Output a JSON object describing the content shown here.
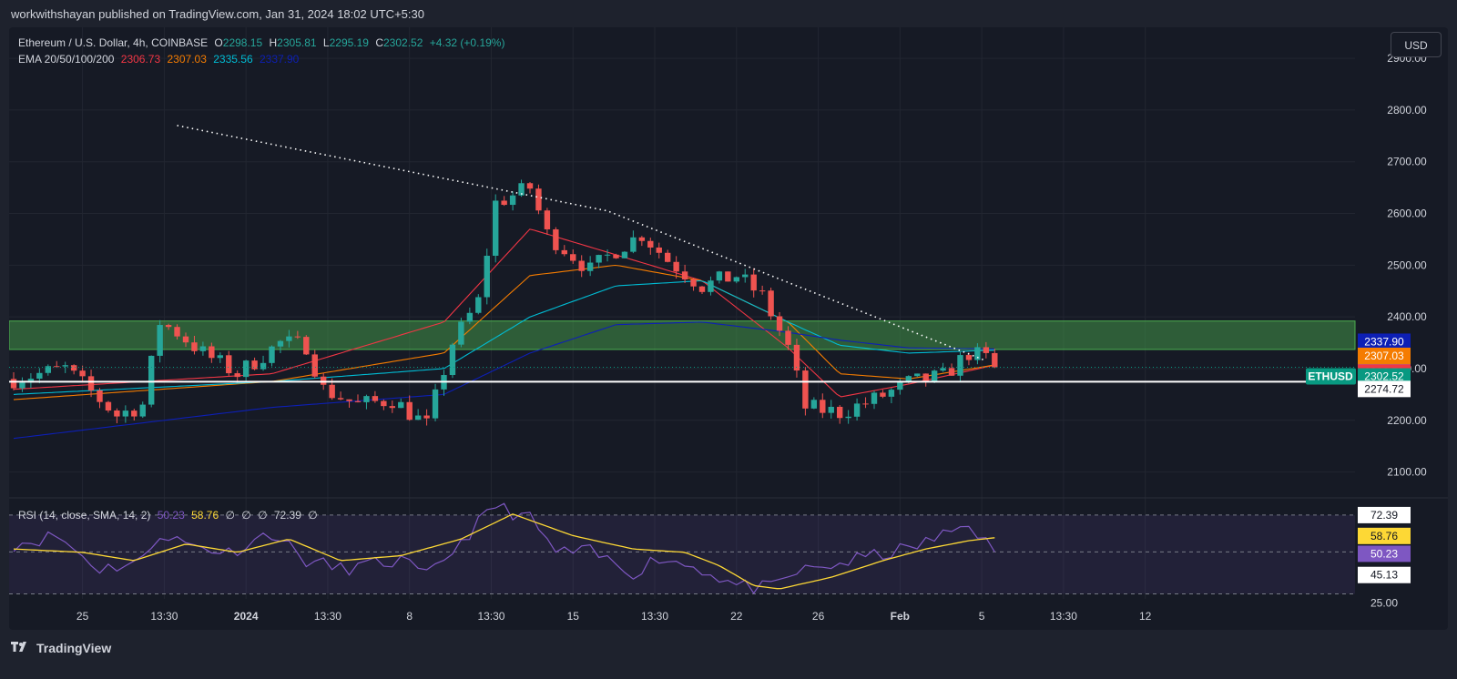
{
  "header": {
    "publisher_text": "workwithshayan published on TradingView.com, Jan 31, 2024 18:02 UTC+5:30"
  },
  "legend": {
    "symbol": "Ethereum / U.S. Dollar, 4h, COINBASE",
    "o_label": "O",
    "o_value": "2298.15",
    "h_label": "H",
    "h_value": "2305.81",
    "l_label": "L",
    "l_value": "2295.19",
    "c_label": "C",
    "c_value": "2302.52",
    "change": "+4.32 (+0.19%)",
    "ema_label": "EMA 20/50/100/200",
    "ema20": "2306.73",
    "ema50": "2307.03",
    "ema100": "2335.56",
    "ema200": "2337.90"
  },
  "rsi_legend": {
    "label": "RSI (14, close, SMA, 14, 2)",
    "rsi": "50.23",
    "sma": "58.76",
    "na1": "∅",
    "na2": "∅",
    "na3": "∅",
    "upper": "72.39",
    "na4": "∅"
  },
  "currency_button": "USD",
  "footer": {
    "brand": "TradingView"
  },
  "colors": {
    "up": "#26a69a",
    "down": "#ef5350",
    "ema20": "#f23645",
    "ema50": "#f57c00",
    "ema100": "#00bcd4",
    "ema200": "#0d1fb5",
    "rsi": "#7e57c2",
    "rsi_sma": "#fdd835",
    "zone": "#2e7d32"
  },
  "chart_data": [
    {
      "type": "candlestick",
      "title": "Ethereum / U.S. Dollar, 4h, COINBASE",
      "ylim": [
        2050,
        2960
      ],
      "y_ticks": [
        2100,
        2200,
        2300,
        2400,
        2500,
        2600,
        2700,
        2800,
        2900
      ],
      "y_tick_labels": [
        "2100.00",
        "2200.00",
        "2300.00",
        "2400.00",
        "2500.00",
        "2600.00",
        "2700.00",
        "2800.00",
        "2900.00"
      ],
      "x_ticks": [
        "25",
        "13:30",
        "2024",
        "13:30",
        "8",
        "13:30",
        "15",
        "13:30",
        "22",
        "26",
        "Feb",
        "5",
        "13:30",
        "12"
      ],
      "x_ticks_bold": [
        "2024",
        "Feb"
      ],
      "x_tick_positions_index": [
        0,
        10,
        20,
        30,
        40,
        50,
        60,
        70,
        80,
        90,
        100,
        110,
        120,
        130
      ],
      "candle_count": 115,
      "price_path": [
        [
          0,
          2280
        ],
        [
          6,
          2300
        ],
        [
          12,
          2210
        ],
        [
          15,
          2230
        ],
        [
          17,
          2390
        ],
        [
          19,
          2370
        ],
        [
          22,
          2330
        ],
        [
          26,
          2290
        ],
        [
          31,
          2350
        ],
        [
          34,
          2345
        ],
        [
          36,
          2260
        ],
        [
          40,
          2230
        ],
        [
          44,
          2240
        ],
        [
          48,
          2190
        ],
        [
          51,
          2350
        ],
        [
          54,
          2430
        ],
        [
          56,
          2620
        ],
        [
          60,
          2650
        ],
        [
          62,
          2560
        ],
        [
          67,
          2490
        ],
        [
          70,
          2530
        ],
        [
          73,
          2560
        ],
        [
          76,
          2510
        ],
        [
          80,
          2460
        ],
        [
          84,
          2480
        ],
        [
          87,
          2440
        ],
        [
          90,
          2340
        ],
        [
          92,
          2225
        ],
        [
          96,
          2215
        ],
        [
          100,
          2240
        ],
        [
          104,
          2272
        ],
        [
          108,
          2285
        ],
        [
          111,
          2330
        ],
        [
          113,
          2320
        ],
        [
          114,
          2302.52
        ]
      ],
      "ema_paths": {
        "ema20": [
          [
            0,
            2260
          ],
          [
            30,
            2290
          ],
          [
            50,
            2390
          ],
          [
            60,
            2570
          ],
          [
            70,
            2520
          ],
          [
            80,
            2470
          ],
          [
            90,
            2340
          ],
          [
            96,
            2245
          ],
          [
            104,
            2270
          ],
          [
            114,
            2306.73
          ]
        ],
        "ema50": [
          [
            0,
            2240
          ],
          [
            30,
            2275
          ],
          [
            50,
            2330
          ],
          [
            60,
            2480
          ],
          [
            70,
            2500
          ],
          [
            80,
            2470
          ],
          [
            90,
            2390
          ],
          [
            96,
            2290
          ],
          [
            104,
            2280
          ],
          [
            114,
            2307.03
          ]
        ],
        "ema100": [
          [
            0,
            2250
          ],
          [
            30,
            2275
          ],
          [
            50,
            2300
          ],
          [
            60,
            2400
          ],
          [
            70,
            2460
          ],
          [
            80,
            2470
          ],
          [
            90,
            2390
          ],
          [
            96,
            2345
          ],
          [
            104,
            2330
          ],
          [
            114,
            2335.56
          ]
        ],
        "ema200": [
          [
            0,
            2165
          ],
          [
            30,
            2225
          ],
          [
            50,
            2250
          ],
          [
            60,
            2330
          ],
          [
            70,
            2385
          ],
          [
            80,
            2390
          ],
          [
            90,
            2370
          ],
          [
            96,
            2355
          ],
          [
            104,
            2340
          ],
          [
            114,
            2337.9
          ]
        ]
      },
      "supply_zone": [
        2337,
        2392
      ],
      "support_line": 2274.72,
      "trendline": [
        [
          19,
          2770
        ],
        [
          69,
          2605
        ],
        [
          113,
          2315
        ]
      ],
      "price_labels": [
        {
          "text": "2337.90",
          "value": 2337.9,
          "bg": "#0d1fb5",
          "fg": "#ffffff"
        },
        {
          "text": "2335.56",
          "value": 2335.56,
          "bg": "#00e5ff",
          "fg": "#131722"
        },
        {
          "text": "2307.03",
          "value": 2307.03,
          "bg": "#f57c00",
          "fg": "#ffffff"
        },
        {
          "text": "2306.73",
          "value": 2306.73,
          "bg": "#f23645",
          "fg": "#ffffff"
        },
        {
          "text": "2302.52",
          "value": 2302.52,
          "bg": "#089981",
          "fg": "#ffffff",
          "tag": "ETHUSD"
        },
        {
          "text": "2274.72",
          "value": 2274.72,
          "bg": "#ffffff",
          "fg": "#131722"
        }
      ]
    },
    {
      "type": "line",
      "title": "RSI (14, close, SMA, 14, 2)",
      "ylim": [
        22,
        80
      ],
      "bands": {
        "upper": 72.39,
        "middle": 50.23,
        "lower": 25.0
      },
      "series": [
        {
          "name": "RSI",
          "points": [
            [
              0,
              55
            ],
            [
              5,
              60
            ],
            [
              10,
              40
            ],
            [
              15,
              45
            ],
            [
              17,
              62
            ],
            [
              20,
              55
            ],
            [
              25,
              50
            ],
            [
              30,
              62
            ],
            [
              34,
              45
            ],
            [
              38,
              40
            ],
            [
              45,
              45
            ],
            [
              48,
              35
            ],
            [
              53,
              62
            ],
            [
              56,
              78
            ],
            [
              60,
              70
            ],
            [
              63,
              50
            ],
            [
              67,
              50
            ],
            [
              72,
              38
            ],
            [
              75,
              47
            ],
            [
              80,
              40
            ],
            [
              84,
              30
            ],
            [
              88,
              28
            ],
            [
              91,
              38
            ],
            [
              95,
              42
            ],
            [
              100,
              48
            ],
            [
              104,
              52
            ],
            [
              108,
              60
            ],
            [
              111,
              68
            ],
            [
              114,
              50.23
            ]
          ]
        },
        {
          "name": "SMA",
          "points": [
            [
              0,
              52
            ],
            [
              8,
              50
            ],
            [
              14,
              45
            ],
            [
              20,
              55
            ],
            [
              26,
              50
            ],
            [
              32,
              58
            ],
            [
              38,
              45
            ],
            [
              45,
              48
            ],
            [
              52,
              58
            ],
            [
              58,
              73
            ],
            [
              65,
              60
            ],
            [
              72,
              52
            ],
            [
              78,
              50
            ],
            [
              82,
              42
            ],
            [
              86,
              30
            ],
            [
              89,
              28
            ],
            [
              95,
              35
            ],
            [
              101,
              45
            ],
            [
              106,
              52
            ],
            [
              111,
              57
            ],
            [
              114,
              58.76
            ]
          ]
        }
      ],
      "axis_labels": [
        {
          "text": "72.39",
          "value": 72.39,
          "bg": "#ffffff",
          "fg": "#131722"
        },
        {
          "text": "58.76",
          "value": 58.76,
          "bg": "#fdd835",
          "fg": "#131722"
        },
        {
          "text": "50.23",
          "value": 50.23,
          "bg": "#7e57c2",
          "fg": "#ffffff"
        },
        {
          "text": "45.13",
          "value": 45.13,
          "bg": "#ffffff",
          "fg": "#131722"
        },
        {
          "text": "25.00",
          "value": 25.0,
          "bg": "none",
          "fg": "#d1d4dc"
        }
      ]
    }
  ]
}
